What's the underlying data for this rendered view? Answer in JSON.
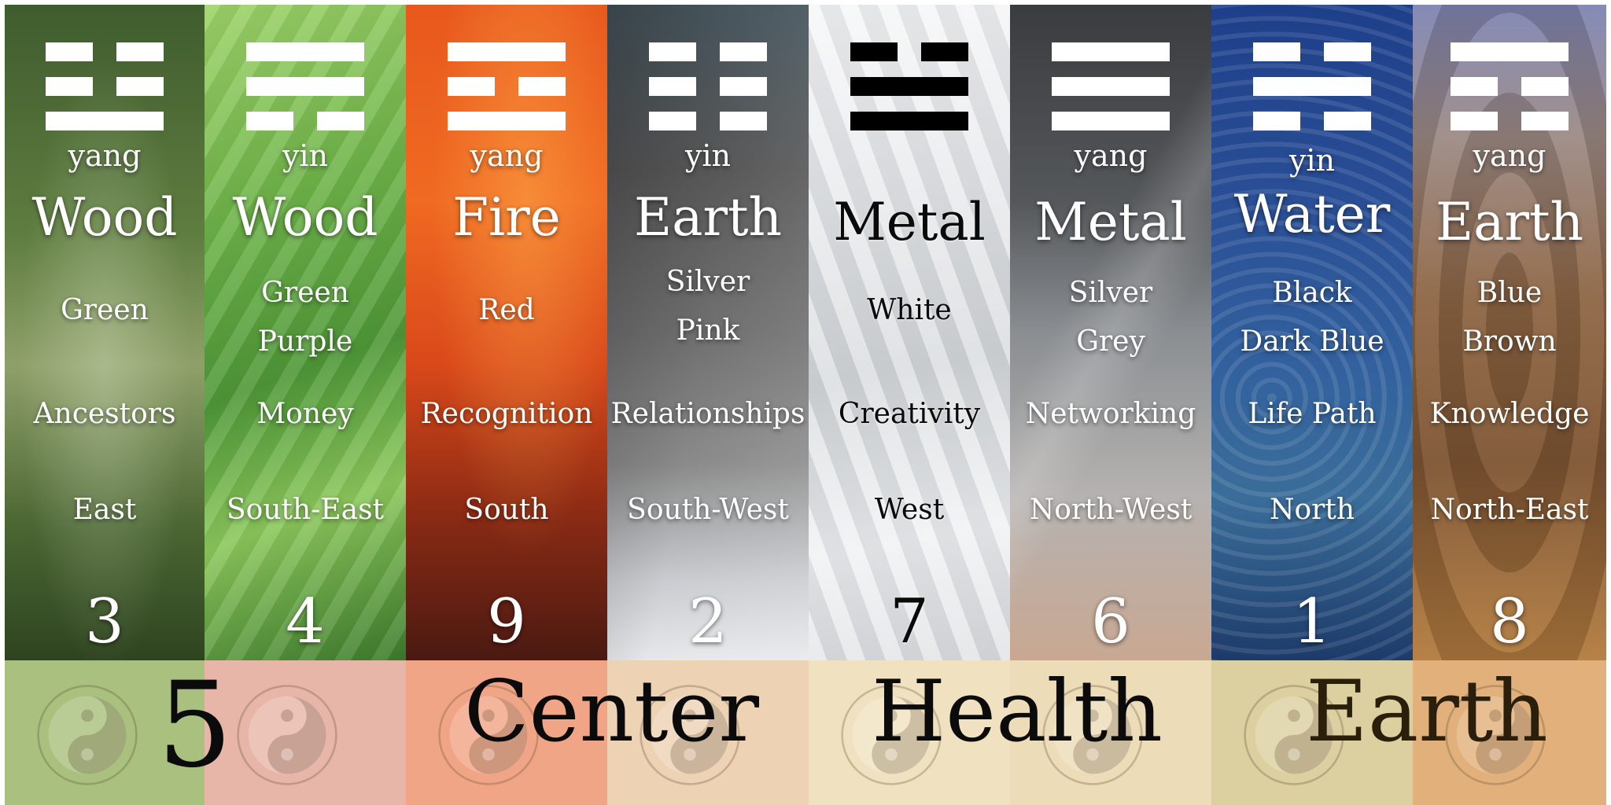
{
  "columns": [
    {
      "polarity": "yang",
      "element": "Wood",
      "colors": [
        "Green",
        ""
      ],
      "aspect": "Ancestors",
      "direction": "East",
      "number": "3",
      "trigram": [
        "broken",
        "broken",
        "solid"
      ]
    },
    {
      "polarity": "yin",
      "element": "Wood",
      "colors": [
        "Green",
        "Purple"
      ],
      "aspect": "Money",
      "direction": "South-East",
      "number": "4",
      "trigram": [
        "solid",
        "solid",
        "broken"
      ]
    },
    {
      "polarity": "yang",
      "element": "Fire",
      "colors": [
        "Red",
        ""
      ],
      "aspect": "Recognition",
      "direction": "South",
      "number": "9",
      "trigram": [
        "solid",
        "broken",
        "solid"
      ]
    },
    {
      "polarity": "yin",
      "element": "Earth",
      "colors": [
        "Silver",
        "Pink"
      ],
      "aspect": "Relationships",
      "direction": "South-West",
      "number": "2",
      "trigram": [
        "broken",
        "broken",
        "broken"
      ]
    },
    {
      "polarity": "",
      "element": "Metal",
      "colors": [
        "White",
        ""
      ],
      "aspect": "Creativity",
      "direction": "West",
      "number": "7",
      "trigram": [
        "broken",
        "solid",
        "solid"
      ]
    },
    {
      "polarity": "yang",
      "element": "Metal",
      "colors": [
        "Silver",
        "Grey"
      ],
      "aspect": "Networking",
      "direction": "North-West",
      "number": "6",
      "trigram": [
        "solid",
        "solid",
        "solid"
      ]
    },
    {
      "polarity": "yin",
      "element": "Water",
      "colors": [
        "Black",
        "Dark Blue"
      ],
      "aspect": "Life Path",
      "direction": "North",
      "number": "1",
      "trigram": [
        "broken",
        "solid",
        "broken"
      ]
    },
    {
      "polarity": "yang",
      "element": "Earth",
      "colors": [
        "Blue",
        "Brown"
      ],
      "aspect": "Knowledge",
      "direction": "North-East",
      "number": "8",
      "trigram": [
        "solid",
        "broken",
        "broken"
      ]
    }
  ],
  "center": {
    "number": "5",
    "label": "Center",
    "aspect": "Health",
    "element": "Earth"
  }
}
